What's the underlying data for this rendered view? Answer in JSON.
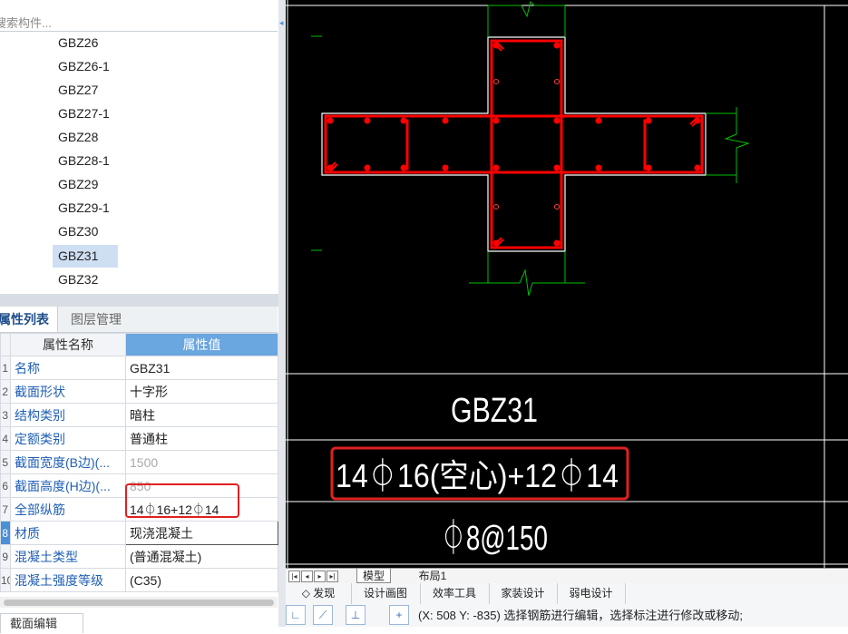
{
  "search": {
    "placeholder": "搜索构件..."
  },
  "component_list": [
    "GBZ26",
    "GBZ26-1",
    "GBZ27",
    "GBZ27-1",
    "GBZ28",
    "GBZ28-1",
    "GBZ29",
    "GBZ29-1",
    "GBZ30",
    "GBZ31",
    "GBZ32"
  ],
  "selected_component": "GBZ31",
  "panel_tabs": {
    "properties": "属性列表",
    "layers": "图层管理"
  },
  "property_table": {
    "header_name": "属性名称",
    "header_value": "属性值",
    "rows": [
      {
        "idx": "1",
        "name": "名称",
        "value": "GBZ31"
      },
      {
        "idx": "2",
        "name": "截面形状",
        "value": "十字形"
      },
      {
        "idx": "3",
        "name": "结构类别",
        "value": "暗柱"
      },
      {
        "idx": "4",
        "name": "定额类别",
        "value": "普通柱"
      },
      {
        "idx": "5",
        "name": "截面宽度(B边)(...",
        "value": "1500"
      },
      {
        "idx": "6",
        "name": "截面高度(H边)(...",
        "value": "850"
      },
      {
        "idx": "7",
        "name": "全部纵筋",
        "value": "14⏀16+12⏀14"
      },
      {
        "idx": "8",
        "name": "材质",
        "value": "现浇混凝土"
      },
      {
        "idx": "9",
        "name": "混凝土类型",
        "value": "(普通混凝土)"
      },
      {
        "idx": "10",
        "name": "混凝土强度等级",
        "value": "(C35)"
      }
    ]
  },
  "bottom_tab": "截面编辑",
  "drawing": {
    "name_label": "GBZ31",
    "longitudinal_rebar_label": "14⏀16(空心)+12⏀14",
    "stirrup_label": "⏀8@150"
  },
  "layout_tabs": {
    "model": "模型",
    "layout1": "布局1"
  },
  "bottom_toolbar": [
    "◇ 发现",
    "设计画图",
    "效率工具",
    "家装设计",
    "弱电设计"
  ],
  "status_text": "(X: 508 Y: -835) 选择钢筋进行编辑，选择标注进行修改或移动;",
  "colors": {
    "accent": "#6aa6df",
    "highlight": "#e02020",
    "rebar": "#ff0000",
    "outline": "#00c000",
    "canvas": "#000000"
  }
}
